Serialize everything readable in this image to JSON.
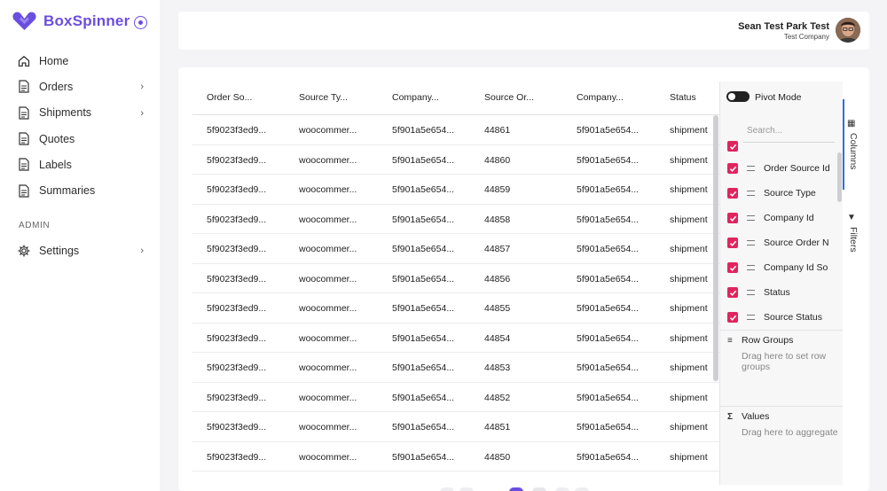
{
  "brand": {
    "name": "BoxSpinner",
    "color": "#6a4ee0"
  },
  "sidebar": {
    "items": [
      {
        "label": "Home",
        "icon": "home-icon",
        "has_children": false
      },
      {
        "label": "Orders",
        "icon": "document-icon",
        "has_children": true
      },
      {
        "label": "Shipments",
        "icon": "document-icon",
        "has_children": true
      },
      {
        "label": "Quotes",
        "icon": "document-icon",
        "has_children": false
      },
      {
        "label": "Labels",
        "icon": "document-icon",
        "has_children": false
      },
      {
        "label": "Summaries",
        "icon": "document-icon",
        "has_children": false
      }
    ],
    "admin_section_label": "ADMIN",
    "admin_items": [
      {
        "label": "Settings",
        "icon": "gear-icon",
        "has_children": true
      }
    ]
  },
  "header": {
    "user_name": "Sean Test Park Test",
    "company": "Test Company"
  },
  "grid": {
    "columns": [
      "Order So...",
      "Source Ty...",
      "Company...",
      "Source Or...",
      "Company...",
      "Status"
    ],
    "rows": [
      [
        "5f9023f3ed9...",
        "woocommer...",
        "5f901a5e654...",
        "44861",
        "5f901a5e654...",
        "shipment"
      ],
      [
        "5f9023f3ed9...",
        "woocommer...",
        "5f901a5e654...",
        "44860",
        "5f901a5e654...",
        "shipment"
      ],
      [
        "5f9023f3ed9...",
        "woocommer...",
        "5f901a5e654...",
        "44859",
        "5f901a5e654...",
        "shipment"
      ],
      [
        "5f9023f3ed9...",
        "woocommer...",
        "5f901a5e654...",
        "44858",
        "5f901a5e654...",
        "shipment"
      ],
      [
        "5f9023f3ed9...",
        "woocommer...",
        "5f901a5e654...",
        "44857",
        "5f901a5e654...",
        "shipment"
      ],
      [
        "5f9023f3ed9...",
        "woocommer...",
        "5f901a5e654...",
        "44856",
        "5f901a5e654...",
        "shipment"
      ],
      [
        "5f9023f3ed9...",
        "woocommer...",
        "5f901a5e654...",
        "44855",
        "5f901a5e654...",
        "shipment"
      ],
      [
        "5f9023f3ed9...",
        "woocommer...",
        "5f901a5e654...",
        "44854",
        "5f901a5e654...",
        "shipment"
      ],
      [
        "5f9023f3ed9...",
        "woocommer...",
        "5f901a5e654...",
        "44853",
        "5f901a5e654...",
        "shipment"
      ],
      [
        "5f9023f3ed9...",
        "woocommer...",
        "5f901a5e654...",
        "44852",
        "5f901a5e654...",
        "shipment"
      ],
      [
        "5f9023f3ed9...",
        "woocommer...",
        "5f901a5e654...",
        "44851",
        "5f901a5e654...",
        "shipment"
      ],
      [
        "5f9023f3ed9...",
        "woocommer...",
        "5f901a5e654...",
        "44850",
        "5f901a5e654...",
        "shipment"
      ]
    ]
  },
  "tool_panel": {
    "pivot_mode_label": "Pivot Mode",
    "pivot_mode_on": false,
    "search_placeholder": "Search...",
    "column_items": [
      {
        "label": "Order Source Id",
        "checked": true
      },
      {
        "label": "Source Type",
        "checked": true
      },
      {
        "label": "Company Id",
        "checked": true
      },
      {
        "label": "Source Order N",
        "checked": true
      },
      {
        "label": "Company Id So",
        "checked": true
      },
      {
        "label": "Status",
        "checked": true
      },
      {
        "label": "Source Status",
        "checked": true
      }
    ],
    "row_groups": {
      "title": "Row Groups",
      "hint": "Drag here to set row groups",
      "icon": "row-groups-icon"
    },
    "values": {
      "title": "Values",
      "hint": "Drag here to aggregate",
      "icon": "sigma-icon"
    },
    "checkbox_color": "#e0245e"
  },
  "side_tabs": [
    {
      "label": "Columns",
      "icon": "columns-grid-icon",
      "active": true
    },
    {
      "label": "Filters",
      "icon": "filter-icon",
      "active": false
    }
  ]
}
